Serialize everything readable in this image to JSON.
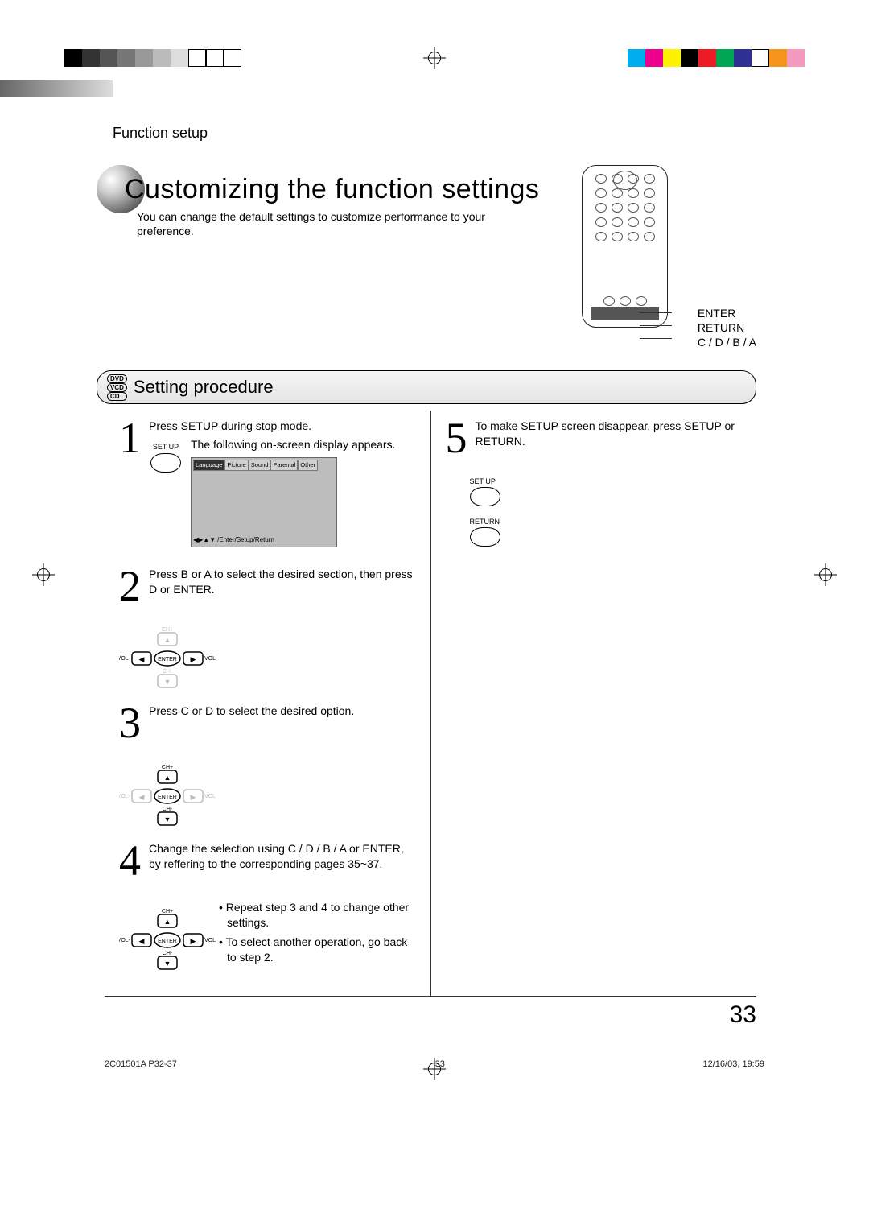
{
  "header": {
    "section_label": "Function setup"
  },
  "title": "Customizing the function settings",
  "intro": "You can change the default settings to customize performance to your preference.",
  "remote_labels": {
    "l1": "ENTER",
    "l2": "RETURN",
    "l3": "C / D / B / A"
  },
  "section": {
    "title": "Setting procedure",
    "badges": [
      "DVD",
      "VCD",
      "CD"
    ]
  },
  "osd": {
    "tabs": [
      "Language",
      "Picture",
      "Sound",
      "Parental",
      "Other"
    ],
    "hint": "/Enter/Setup/Return"
  },
  "steps": {
    "s1": {
      "a": "Press SETUP during stop mode.",
      "b": "The following on-screen display appears.",
      "btn": "SET UP"
    },
    "s2": "Press  B  or  A  to select the desired section, then press  D  or ENTER.",
    "s3": "Press  C  or  D  to select the desired option.",
    "s4": "Change the selection using    C / D / B / A  or ENTER, by reffering to the corresponding pages 35~37.",
    "s4_b1": "• Repeat step 3 and 4 to change other settings.",
    "s4_b2": "• To select another operation, go back to step 2.",
    "s5": "To make SETUP screen disappear, press SETUP or RETURN.",
    "s5_btn_a": "SET UP",
    "s5_btn_b": "RETURN"
  },
  "dpad": {
    "chp": "CH+",
    "chm": "CH-",
    "volp": "VOL+",
    "volm": "VOL-",
    "enter": "ENTER"
  },
  "page_number": "33",
  "footer": {
    "left": "2C01501A P32-37",
    "mid": "33",
    "right": "12/16/03, 19:59"
  },
  "colors": {
    "bw": [
      "#000",
      "#333",
      "#555",
      "#777",
      "#999",
      "#bbb",
      "#ddd",
      "#fff",
      "#fff",
      "#fff"
    ],
    "color": [
      "#00adef",
      "#ec008c",
      "#fff200",
      "#000",
      "#ed1c24",
      "#00a651",
      "#2e3192",
      "#fff",
      "#f7941d",
      "#f49ac1"
    ]
  }
}
